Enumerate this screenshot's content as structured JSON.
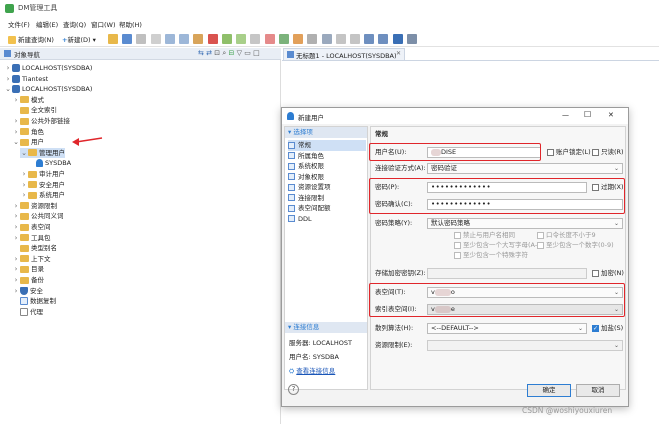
{
  "app": {
    "title": "DM管理工具",
    "menu": [
      "文件(F)",
      "编辑(E)",
      "查询(Q)",
      "窗口(W)",
      "帮助(H)"
    ],
    "toolbar": {
      "new_query": "新建查询(N)",
      "new": "新建(D)"
    }
  },
  "nav_panel": {
    "title": "对象导航",
    "tree": [
      {
        "label": "LOCALHOST(SYSDBA)",
        "level": 0,
        "icon": "db",
        "chevron": "›"
      },
      {
        "label": "Tiantest",
        "level": 0,
        "icon": "db",
        "chevron": "›"
      },
      {
        "label": "LOCALHOST(SYSDBA)",
        "level": 0,
        "icon": "db",
        "chevron": "⌄"
      },
      {
        "label": "模式",
        "level": 1,
        "icon": "folder",
        "chevron": "›"
      },
      {
        "label": "全文索引",
        "level": 1,
        "icon": "folder",
        "chevron": ""
      },
      {
        "label": "公共外部链接",
        "level": 1,
        "icon": "folder",
        "chevron": "›"
      },
      {
        "label": "角色",
        "level": 1,
        "icon": "folder",
        "chevron": "›"
      },
      {
        "label": "用户",
        "level": 1,
        "icon": "folder",
        "chevron": "⌄"
      },
      {
        "label": "管理用户",
        "level": 2,
        "icon": "folder",
        "chevron": "⌄"
      },
      {
        "label": "SYSDBA",
        "level": 3,
        "icon": "user",
        "chevron": ""
      },
      {
        "label": "审计用户",
        "level": 2,
        "icon": "folder",
        "chevron": "›"
      },
      {
        "label": "安全用户",
        "level": 2,
        "icon": "folder",
        "chevron": "›"
      },
      {
        "label": "系统用户",
        "level": 2,
        "icon": "folder",
        "chevron": "›"
      },
      {
        "label": "资源限制",
        "level": 1,
        "icon": "folder",
        "chevron": "›"
      },
      {
        "label": "公共同义词",
        "level": 1,
        "icon": "folder",
        "chevron": "›"
      },
      {
        "label": "表空间",
        "level": 1,
        "icon": "folder",
        "chevron": "›"
      },
      {
        "label": "工具包",
        "level": 1,
        "icon": "folder",
        "chevron": "›"
      },
      {
        "label": "类型别名",
        "level": 1,
        "icon": "folder",
        "chevron": ""
      },
      {
        "label": "上下文",
        "level": 1,
        "icon": "folder",
        "chevron": "›"
      },
      {
        "label": "目录",
        "level": 1,
        "icon": "folder",
        "chevron": "›"
      },
      {
        "label": "备份",
        "level": 1,
        "icon": "folder",
        "chevron": "›"
      },
      {
        "label": "安全",
        "level": 1,
        "icon": "shield",
        "chevron": "›"
      },
      {
        "label": "数据复制",
        "level": 1,
        "icon": "copy",
        "chevron": ""
      },
      {
        "label": "代理",
        "level": 1,
        "icon": "agent",
        "chevron": ""
      }
    ]
  },
  "editor_tab": {
    "label": "无标题1 - LOCALHOST(SYSDBA)"
  },
  "dialog": {
    "title": "新建用户",
    "controls": {
      "minimize": "—",
      "maximize": "☐",
      "close": "✕"
    },
    "left_section_title": "选择项",
    "left_items": [
      "常规",
      "所属角色",
      "系统权限",
      "对象权限",
      "资源设置项",
      "连接限制",
      "表空间配额",
      "DDL"
    ],
    "conn_section_title": "连接信息",
    "conn_server": "服务器: LOCALHOST",
    "conn_user": "用户名: SYSDBA",
    "conn_link": "查看连接信息",
    "section_title": "常规",
    "username_label": "用户名(U):",
    "username_value": "DISE",
    "account_lock": "账户锁定(L)",
    "readonly": "只读(R)",
    "auth_mode_label": "连接验证方式(A):",
    "auth_mode_value": "密码验证",
    "password_label": "密码(P):",
    "password_value": "•••••••••••••",
    "expired": "过期(X)",
    "password_confirm_label": "密码确认(C):",
    "password_confirm_value": "•••••••••••••",
    "policy_label": "密码策略(Y):",
    "policy_value": "默认密码策略",
    "policy_opts": [
      "禁止与用户名相同",
      "口令长度不小于9",
      "至少包含一个大写字母(A-Z)",
      "至少包含一个数字(0-9)",
      "至少包含一个特殊字符"
    ],
    "encrypt_pwd_label": "存储加密密钥(Z):",
    "encrypt_label": "加密(N)",
    "tablespace_label": "表空间(T):",
    "tablespace_value": "v",
    "tablespace_value_tail": "o",
    "index_ts_label": "索引表空间(I):",
    "index_ts_value": "v",
    "index_ts_value_tail": "e",
    "hash_label": "散列算法(H):",
    "hash_value": "<--DEFAULT-->",
    "salt_label": "加盐(S)",
    "resource_label": "资源限制(E):",
    "help_icon": "?",
    "ok": "确定",
    "cancel": "取消"
  },
  "watermark": "CSDN @woshiyouxiuren",
  "colors": {
    "highlight_red": "#e0262b",
    "accent_blue": "#2d7dd2",
    "dialog_bg": "#f3f3f3",
    "nav_bg": "#ffffff"
  }
}
